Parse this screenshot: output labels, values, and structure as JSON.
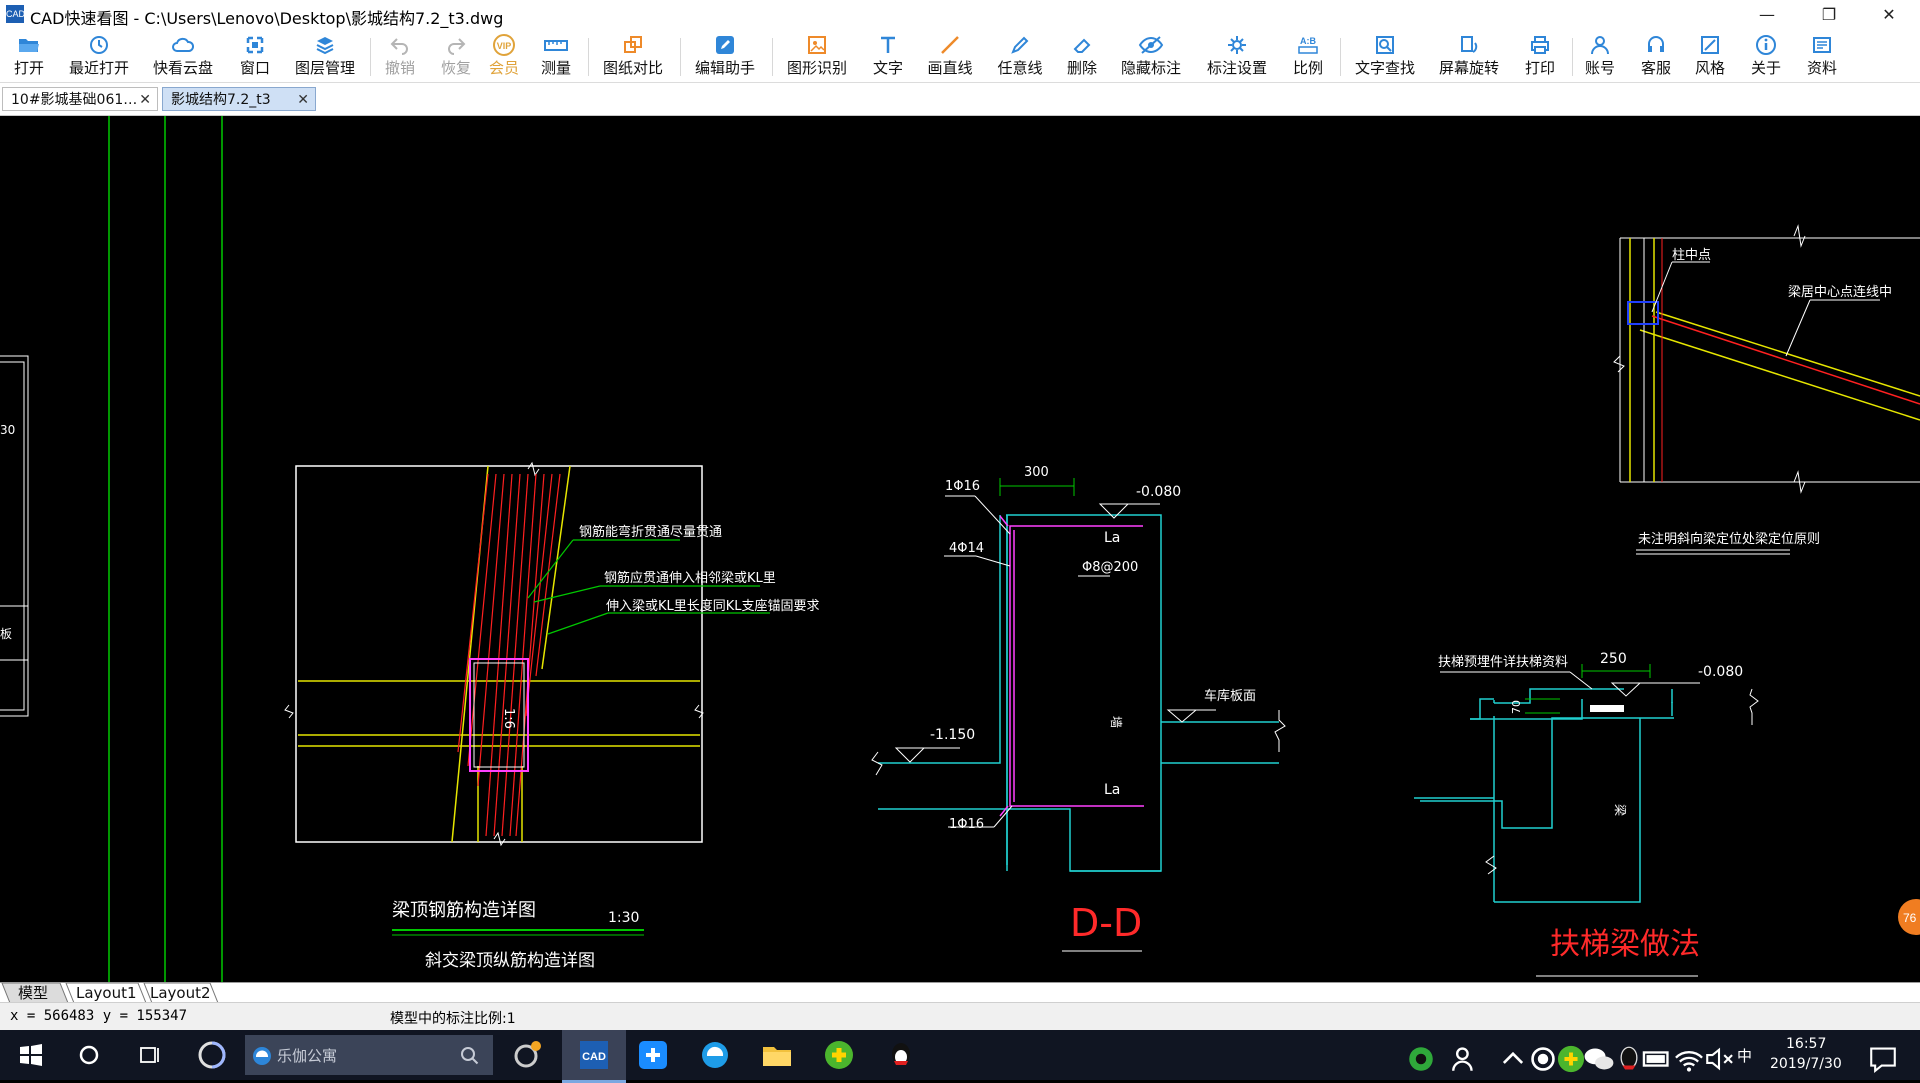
{
  "window": {
    "title": "CAD快速看图 - C:\\Users\\Lenovo\\Desktop\\影城结构7.2_t3.dwg",
    "app_icon": "CAD",
    "minimize": "—",
    "restore": "❐",
    "close": "✕"
  },
  "toolbar": [
    {
      "label": "打开",
      "icon": "folder-open-icon"
    },
    {
      "label": "最近打开",
      "icon": "history-icon"
    },
    {
      "label": "快看云盘",
      "icon": "cloud-icon"
    },
    {
      "label": "窗口",
      "icon": "window-icon"
    },
    {
      "label": "图层管理",
      "icon": "layers-icon"
    },
    {
      "label": "撤销",
      "icon": "undo-icon",
      "disabled": true
    },
    {
      "label": "恢复",
      "icon": "redo-icon",
      "disabled": true
    },
    {
      "label": "会员",
      "icon": "vip-icon",
      "badge": "VIP"
    },
    {
      "label": "测量",
      "icon": "ruler-icon"
    },
    {
      "label": "图纸对比",
      "icon": "compare-icon"
    },
    {
      "label": "编辑助手",
      "icon": "edit-assistant-icon"
    },
    {
      "label": "图形识别",
      "icon": "shape-recognition-icon"
    },
    {
      "label": "文字",
      "icon": "text-icon"
    },
    {
      "label": "画直线",
      "icon": "line-icon"
    },
    {
      "label": "任意线",
      "icon": "pen-icon"
    },
    {
      "label": "删除",
      "icon": "eraser-icon"
    },
    {
      "label": "隐藏标注",
      "icon": "eye-icon"
    },
    {
      "label": "标注设置",
      "icon": "annotation-settings-icon"
    },
    {
      "label": "比例",
      "icon": "scale-icon",
      "badge": "A:B"
    },
    {
      "label": "文字查找",
      "icon": "text-search-icon"
    },
    {
      "label": "屏幕旋转",
      "icon": "rotate-screen-icon"
    },
    {
      "label": "打印",
      "icon": "printer-icon"
    },
    {
      "label": "账号",
      "icon": "user-icon"
    },
    {
      "label": "客服",
      "icon": "headset-icon"
    },
    {
      "label": "风格",
      "icon": "style-icon"
    },
    {
      "label": "关于",
      "icon": "info-icon"
    },
    {
      "label": "资料",
      "icon": "library-icon"
    }
  ],
  "tabs": [
    {
      "label": "10#影城基础061…",
      "close": "✕",
      "active": false
    },
    {
      "label": "影城结构7.2_t3",
      "close": "✕",
      "active": true
    }
  ],
  "drawing": {
    "left_fragments": {
      "a": "30",
      "b": "板"
    },
    "detail1": {
      "note1": "钢筋能弯折贯通尽量贯通",
      "note2": "钢筋应贯通伸入相邻梁或KL里",
      "note3": "伸入梁或KL里长度同KL支座锚固要求",
      "vertical_label": "1:6",
      "title": "梁顶钢筋构造详图",
      "scale": "1:30",
      "subtitle": "斜交梁顶纵筋构造详图"
    },
    "detail_dd": {
      "dim_300": "300",
      "top_rebar": "1Φ16",
      "elev_top": "-0.080",
      "la_top": "La",
      "stirrup": "Φ8@200",
      "side_rebar": "4Φ14",
      "elev_bottom": "-1.150",
      "wall": "墙",
      "slab_label": "车库板面",
      "la_bottom": "La",
      "bottom_rebar": "1Φ16",
      "title": "D-D"
    },
    "detail_stair": {
      "embed_note": "扶梯预埋件详扶梯资料",
      "dim_250": "250",
      "elev": "-0.080",
      "dim_70": "70",
      "beam": "梁",
      "title": "扶梯梁做法"
    },
    "detail_top_right": {
      "column_center": "柱中点",
      "beam_center_line": "梁居中心点连线中",
      "principle": "未注明斜向梁定位处梁定位原则"
    },
    "float_badge": "76"
  },
  "layout_tabs": [
    "模型",
    "Layout1",
    "Layout2"
  ],
  "status": {
    "coords": "x = 566483  y = 155347",
    "scale": "模型中的标注比例:1"
  },
  "taskbar": {
    "search_placeholder": "乐伽公寓",
    "ime": "中",
    "time": "16:57",
    "date": "2019/7/30"
  },
  "colors": {
    "cad_yellow": "#e6e600",
    "cad_red": "#ff2020",
    "cad_green": "#00c800",
    "cad_cyan": "#20d0d0",
    "cad_magenta": "#ff40ff",
    "cad_white": "#ffffff",
    "title_red": "#ff2a2a"
  }
}
